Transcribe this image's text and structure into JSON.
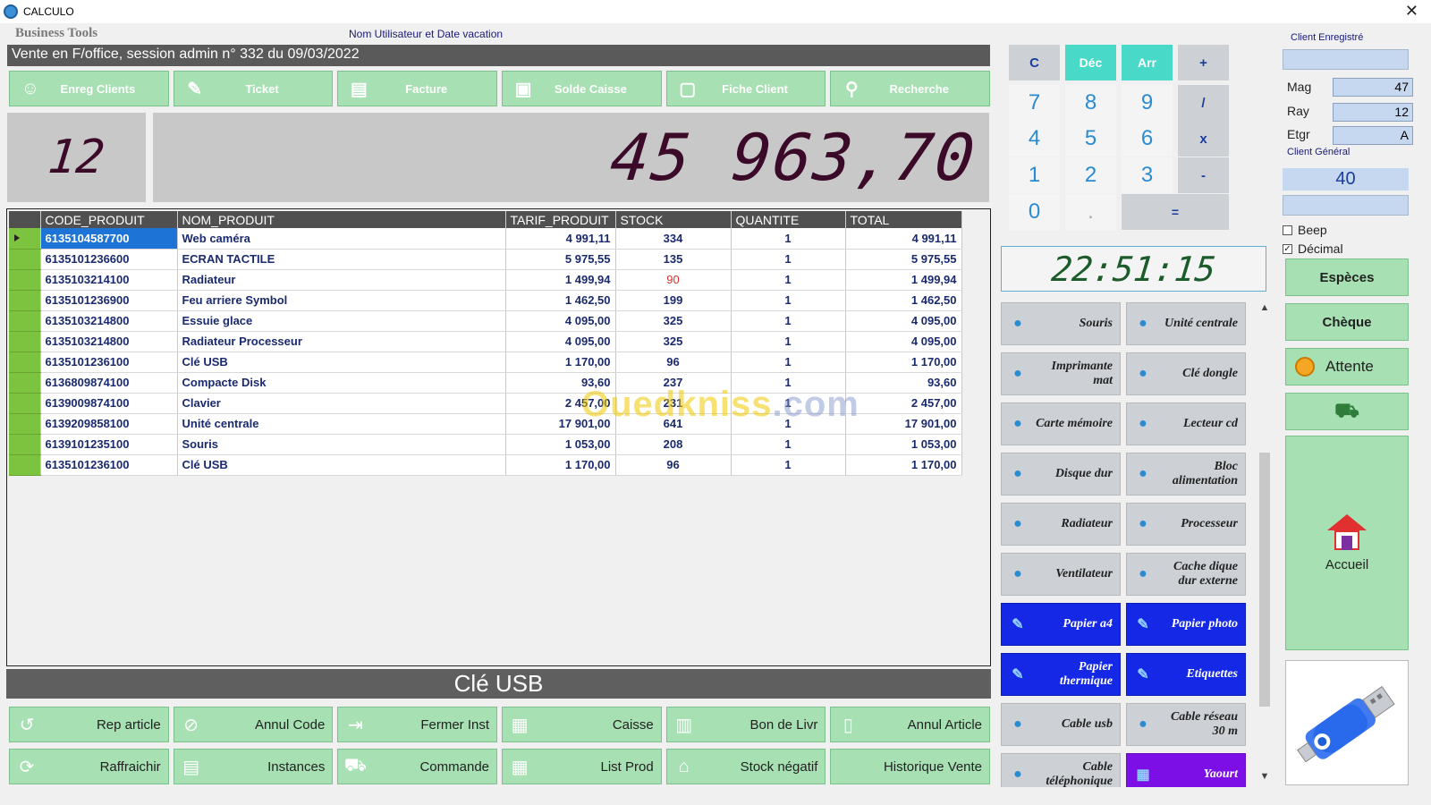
{
  "window": {
    "title": "CALCULO"
  },
  "header": {
    "brand": "Business Tools",
    "user_date_label": "Nom Utilisateur et Date vacation",
    "session_text": "Vente en F/office, session  admin n° 332 du 09/03/2022"
  },
  "toolbar": [
    {
      "label": "Enreg Clients",
      "icon": "user-icon"
    },
    {
      "label": "Ticket",
      "icon": "ticket-icon"
    },
    {
      "label": "Facture",
      "icon": "invoice-icon"
    },
    {
      "label": "Solde Caisse",
      "icon": "box-icon"
    },
    {
      "label": "Fiche Client",
      "icon": "client-card-icon"
    },
    {
      "label": "Recherche",
      "icon": "search-icon"
    }
  ],
  "display": {
    "count": "12",
    "total": "45 963,70"
  },
  "grid": {
    "columns": [
      "CODE_PRODUIT",
      "NOM_PRODUIT",
      "TARIF_PRODUIT",
      "STOCK",
      "QUANTITE",
      "TOTAL"
    ],
    "rows": [
      [
        "6135104587700",
        "Web caméra",
        "4 991,11",
        "334",
        "1",
        "4 991,11"
      ],
      [
        "6135101236600",
        "ECRAN TACTILE",
        "5 975,55",
        "135",
        "1",
        "5 975,55"
      ],
      [
        "6135103214100",
        "Radiateur",
        "1 499,94",
        "90",
        "1",
        "1 499,94"
      ],
      [
        "6135101236900",
        "Feu arriere Symbol",
        "1 462,50",
        "199",
        "1",
        "1 462,50"
      ],
      [
        "6135103214800",
        "Essuie glace",
        "4 095,00",
        "325",
        "1",
        "4 095,00"
      ],
      [
        "6135103214800",
        "Radiateur Processeur",
        "4 095,00",
        "325",
        "1",
        "4 095,00"
      ],
      [
        "6135101236100",
        "Clé USB",
        "1 170,00",
        "96",
        "1",
        "1 170,00"
      ],
      [
        "6136809874100",
        "Compacte Disk",
        "93,60",
        "237",
        "1",
        "93,60"
      ],
      [
        "6139009874100",
        "Clavier",
        "2 457,00",
        "231",
        "1",
        "2 457,00"
      ],
      [
        "6139209858100",
        "Unité centrale",
        "17 901,00",
        "641",
        "1",
        "17 901,00"
      ],
      [
        "6139101235100",
        "Souris",
        "1 053,00",
        "208",
        "1",
        "1 053,00"
      ],
      [
        "6135101236100",
        "Clé USB",
        "1 170,00",
        "96",
        "1",
        "1 170,00"
      ]
    ],
    "low_stock_color": "#e03030",
    "selected_row": 0
  },
  "watermark": {
    "part1": "Ouedkniss",
    "part2": ".com"
  },
  "selected_product": "Clé USB",
  "bottom_buttons_row1": [
    {
      "label": "Rep article",
      "icon": "repeat-icon"
    },
    {
      "label": "Annul Code",
      "icon": "cancel-code-icon"
    },
    {
      "label": "Fermer Inst",
      "icon": "close-instance-icon"
    },
    {
      "label": "Caisse",
      "icon": "cash-register-icon"
    },
    {
      "label": "Bon de Livr",
      "icon": "delivery-note-icon"
    },
    {
      "label": "Annul Article",
      "icon": "cancel-article-icon"
    }
  ],
  "bottom_buttons_row2": [
    {
      "label": "Raffraichir",
      "icon": "refresh-icon"
    },
    {
      "label": "Instances",
      "icon": "instances-icon"
    },
    {
      "label": "Commande",
      "icon": "order-truck-icon"
    },
    {
      "label": "List Prod",
      "icon": "product-list-icon"
    },
    {
      "label": "Stock négatif",
      "icon": "negative-stock-icon"
    },
    {
      "label": "Historique Vente",
      "icon": ""
    }
  ],
  "calculator": {
    "keys": [
      "C",
      "Déc",
      "Arr",
      "+",
      "7",
      "8",
      "9",
      "/",
      "4",
      "5",
      "6",
      "x",
      "1",
      "2",
      "3",
      "-",
      "0",
      ".",
      "="
    ]
  },
  "clock": "22:51:15",
  "quick_products": [
    {
      "label": "Souris",
      "style": "gray"
    },
    {
      "label": "Unité centrale",
      "style": "gray"
    },
    {
      "label": "Imprimante mat",
      "style": "gray"
    },
    {
      "label": "Clé dongle",
      "style": "gray"
    },
    {
      "label": "Carte mémoire",
      "style": "gray"
    },
    {
      "label": "Lecteur cd",
      "style": "gray"
    },
    {
      "label": "Disque dur",
      "style": "gray"
    },
    {
      "label": "Bloc alimentation",
      "style": "gray"
    },
    {
      "label": "Radiateur",
      "style": "gray"
    },
    {
      "label": "Processeur",
      "style": "gray"
    },
    {
      "label": "Ventilateur",
      "style": "gray"
    },
    {
      "label": "Cache dique dur externe",
      "style": "gray"
    },
    {
      "label": "Papier a4",
      "style": "blue"
    },
    {
      "label": "Papier photo",
      "style": "blue"
    },
    {
      "label": "Papier thermique",
      "style": "blue"
    },
    {
      "label": "Etiquettes",
      "style": "blue"
    },
    {
      "label": "Cable usb",
      "style": "gray"
    },
    {
      "label": "Cable réseau 30 m",
      "style": "gray"
    },
    {
      "label": "Cable téléphonique",
      "style": "gray"
    },
    {
      "label": "Yaourt",
      "style": "purple"
    }
  ],
  "right_panel": {
    "client_enregistre_label": "Client Enregistré",
    "mag_label": "Mag",
    "mag_value": "47",
    "ray_label": "Ray",
    "ray_value": "12",
    "etgr_label": "Etgr",
    "etgr_value": "A",
    "client_general_label": "Client Général",
    "client_general_value": "40",
    "beep_label": "Beep",
    "beep_checked": false,
    "decimal_label": "Décimal",
    "decimal_checked": true,
    "especes_label": "Espèces",
    "cheque_label": "Chèque",
    "attente_label": "Attente",
    "accueil_label": "Accueil"
  },
  "colors": {
    "button_green": "#a7e0b2",
    "header_gray": "#505050",
    "selection_blue": "#1e74d6",
    "row_marker_green": "#7cc33f",
    "quick_blue": "#1428e6",
    "quick_purple": "#7b0fe6",
    "seven_segment": "#3a0a28"
  }
}
